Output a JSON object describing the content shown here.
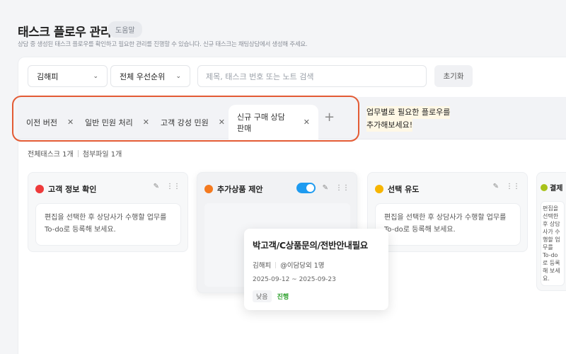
{
  "header": {
    "title": "태스크 플로우 관리",
    "help_label": "도움말",
    "description": "상담 중 생성된 태스크 플로우를 확인하고 필요한 관리를 진행할 수 있습니다. 신규 태스크는 채팅상담에서 생성해 주세요."
  },
  "filters": {
    "assignee": "김해피",
    "priority": "전체 우선순위",
    "search_placeholder": "제목, 태스크 번호 또는 노트 검색",
    "reset_label": "초기화"
  },
  "tabs": [
    {
      "label": "이전 버전",
      "active": false
    },
    {
      "label": "일반 민원 처리",
      "active": false
    },
    {
      "label": "고객 강성 민원",
      "active": false
    },
    {
      "label": "신규 구매 상담 판매",
      "active": true
    }
  ],
  "tab_hint": {
    "line1": "업무별로 필요한 플로우를",
    "line2": "추가해보세요!"
  },
  "counts": {
    "tasks": "전체태스크 1개",
    "files": "첨부파일 1개"
  },
  "columns": [
    {
      "title": "고객 정보 확인",
      "color": "#ee3b3b",
      "todo_line1": "편집을 선택한 후 상담사가 수행할 업무를",
      "todo_line2": "To-do로 등록해 보세요."
    },
    {
      "title": "추가상품 제안",
      "color": "#f47a1f",
      "toggle_on": true
    },
    {
      "title": "선택 유도",
      "color": "#f7b500",
      "todo_line1": "편집을 선택한 후 상담사가 수행할 업무를",
      "todo_line2": "To-do로 등록해 보세요."
    },
    {
      "title": "결제",
      "color": "#a8c21a",
      "todo_line1": "편집을 선택한 후 상담사가 수행할 업무를",
      "todo_line2": "To-do로 등록해 보세요."
    }
  ],
  "task_card": {
    "title": "박고객/C상품문의/전반안내필요",
    "owner": "김해피",
    "mentions": "@이담당외 1명",
    "dates": "2025-09-12 ~ 2025-09-23",
    "priority": "낮음",
    "status": "진행",
    "status_color": "#2ca02c"
  }
}
